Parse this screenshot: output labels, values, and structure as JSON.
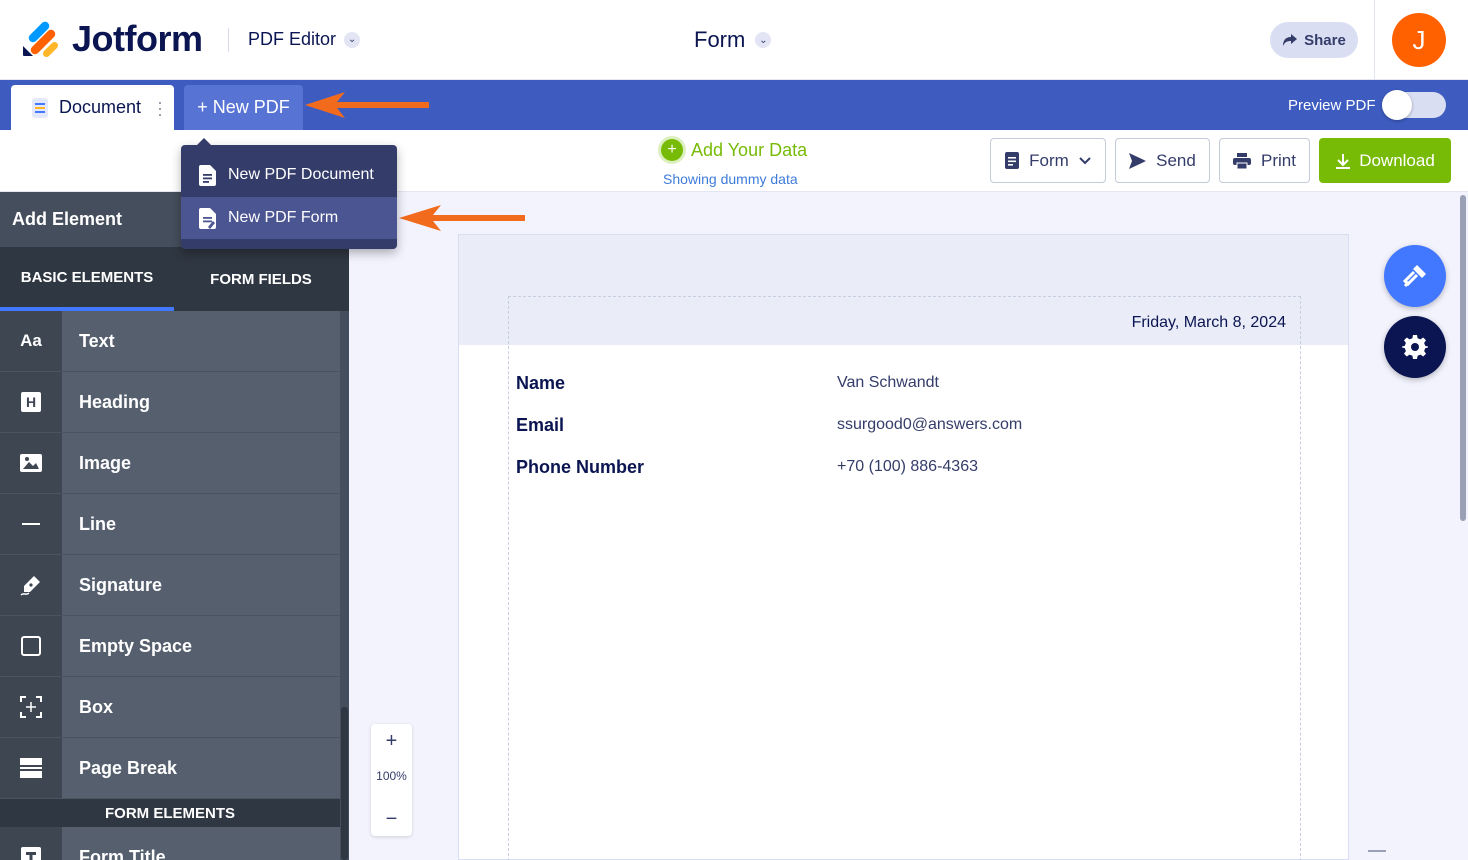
{
  "header": {
    "brand": "Jotform",
    "app_name": "PDF Editor",
    "form_title": "Form",
    "share_label": "Share",
    "avatar_initial": "J",
    "avatar_color": "#ff6100"
  },
  "tabs": {
    "document_label": "Document",
    "new_pdf_label": "+ New PDF",
    "preview_label": "Preview PDF",
    "preview_enabled": false
  },
  "dropdown": {
    "items": [
      {
        "label": "New PDF Document",
        "icon": "document-icon"
      },
      {
        "label": "New PDF Form",
        "icon": "form-document-icon"
      }
    ]
  },
  "toolbar": {
    "add_data_label": "Add Your Data",
    "dummy_label": "Showing dummy data",
    "form_label": "Form",
    "send_label": "Send",
    "print_label": "Print",
    "download_label": "Download",
    "download_color": "#78bb07"
  },
  "left_panel": {
    "title": "Add Element",
    "tabs": [
      "BASIC ELEMENTS",
      "FORM FIELDS"
    ],
    "items": [
      {
        "label": "Text",
        "icon": "Aa"
      },
      {
        "label": "Heading",
        "icon": "H"
      },
      {
        "label": "Image",
        "icon": "image-icon"
      },
      {
        "label": "Line",
        "icon": "line-icon"
      },
      {
        "label": "Signature",
        "icon": "signature-icon"
      },
      {
        "label": "Empty Space",
        "icon": "empty-space-icon"
      },
      {
        "label": "Box",
        "icon": "box-icon"
      },
      {
        "label": "Page Break",
        "icon": "page-break-icon"
      }
    ],
    "section_label": "FORM ELEMENTS",
    "section_items": [
      {
        "label": "Form Title",
        "icon": "form-title-icon"
      }
    ]
  },
  "zoom": {
    "plus": "+",
    "level": "100%",
    "minus": "−"
  },
  "page": {
    "date": "Friday, March 8, 2024",
    "fields": [
      {
        "label": "Name",
        "value": "Van Schwandt"
      },
      {
        "label": "Email",
        "value": "ssurgood0@answers.com"
      },
      {
        "label": "Phone Number",
        "value": "+70 (100) 886-4363"
      }
    ]
  }
}
